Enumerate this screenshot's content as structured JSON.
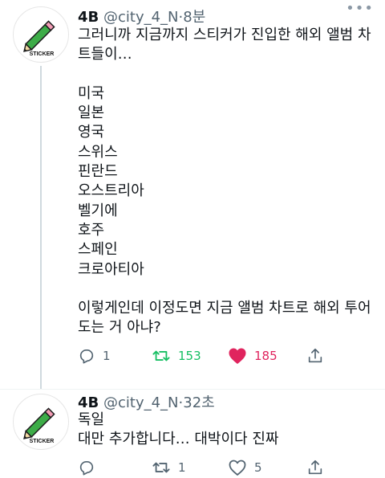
{
  "tweets": [
    {
      "display_name": "4B",
      "handle": "@city_4_N",
      "separator": "·",
      "time": "8분",
      "avatar_label": "STICKER",
      "body": "그러니까 지금까지 스티커가 진입한 해외 앨범 차트들이…\n\n미국\n일본\n영국\n스위스\n핀란드\n오스트리아\n벨기에\n호주\n스페인\n크로아티아\n\n이렇게인데 이정도면 지금 앨범 차트로 해외 투어 도는 거 아냐?",
      "reply_count": "1",
      "retweet_count": "153",
      "like_count": "185",
      "retweeted": true,
      "liked": true
    },
    {
      "display_name": "4B",
      "handle": "@city_4_N",
      "separator": "·",
      "time": "32초",
      "avatar_label": "STICKER",
      "body": "독일\n대만 추가합니다… 대박이다 진짜",
      "reply_count": "",
      "retweet_count": "1",
      "like_count": "5",
      "retweeted": false,
      "liked": false
    }
  ],
  "colors": {
    "retweet_active": "#17bf63",
    "like_active": "#e0245e",
    "icon_default": "#536471",
    "thread_line": "#cfd9de"
  }
}
